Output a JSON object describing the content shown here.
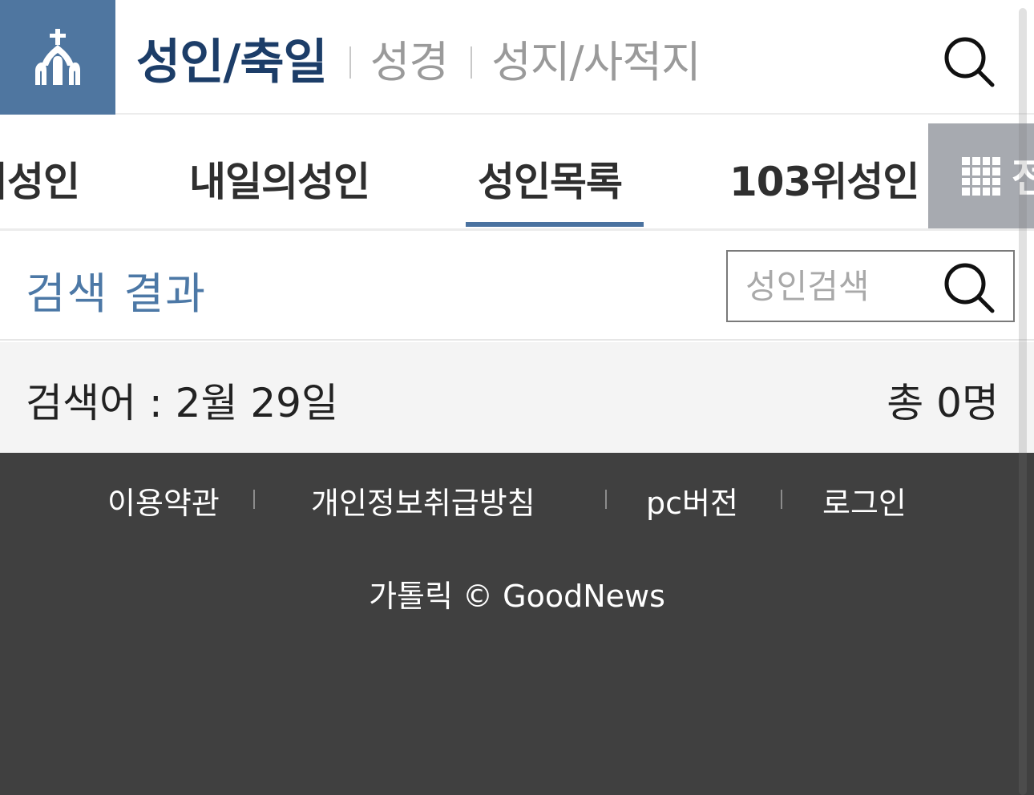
{
  "header": {
    "logo_icon": "church-icon",
    "nav": {
      "active": "성인/축일",
      "items": [
        "성경",
        "성지/사적지"
      ]
    },
    "search_icon": "search-icon"
  },
  "tabs": {
    "items": [
      "오늘의성인",
      "내일의성인",
      "성인목록",
      "103위성인"
    ],
    "selected": "성인목록",
    "all_menu": {
      "icon": "grid-icon",
      "label": "전체"
    }
  },
  "search": {
    "title": "검색 결과",
    "placeholder": "성인검색",
    "button_icon": "search-icon"
  },
  "summary": {
    "keyword": "검색어 : 2월 29일",
    "total": "총 0명"
  },
  "footer": {
    "links": [
      "이용약관",
      "개인정보취급방침",
      "pc버전",
      "로그인"
    ],
    "copyright": "가톨릭 © GoodNews"
  },
  "colors": {
    "brand": "#4f76a0",
    "active_nav": "#1c3d68",
    "accent": "#4a72a0",
    "footer_bg": "#404040",
    "summary_bg": "#f4f4f4"
  }
}
